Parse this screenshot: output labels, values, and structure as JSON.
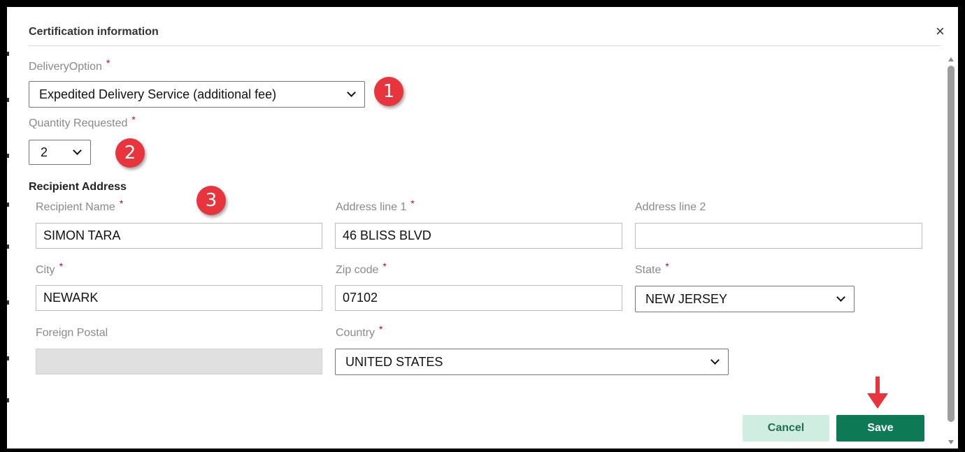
{
  "dialog": {
    "title": "Certification information",
    "close_glyph": "×"
  },
  "delivery_option": {
    "label": "DeliveryOption",
    "required_mark": "*",
    "value": "Expedited Delivery Service (additional fee)"
  },
  "quantity": {
    "label": "Quantity Requested",
    "required_mark": "*",
    "value": "2"
  },
  "recipient_address": {
    "section_title": "Recipient Address",
    "recipient_name": {
      "label": "Recipient Name",
      "required_mark": "*",
      "value": "SIMON TARA"
    },
    "address_line_1": {
      "label": "Address line 1",
      "required_mark": "*",
      "value": "46 BLISS BLVD"
    },
    "address_line_2": {
      "label": "Address line 2",
      "value": ""
    },
    "city": {
      "label": "City",
      "required_mark": "*",
      "value": "NEWARK"
    },
    "zip_code": {
      "label": "Zip code",
      "required_mark": "*",
      "value": "07102"
    },
    "state": {
      "label": "State",
      "required_mark": "*",
      "value": "NEW JERSEY"
    },
    "foreign_postal": {
      "label": "Foreign Postal",
      "value": ""
    },
    "country": {
      "label": "Country",
      "required_mark": "*",
      "value": "UNITED STATES"
    }
  },
  "buttons": {
    "cancel_label": "Cancel",
    "save_label": "Save"
  },
  "annotations": {
    "badge_1": "1",
    "badge_2": "2",
    "badge_3": "3"
  },
  "colors": {
    "required": "#a0142a",
    "save_bg": "#0e7a55",
    "cancel_bg": "#cfeee1",
    "badge": "#e8343c",
    "arrow": "#e8343c"
  },
  "icons": {
    "close": "close-icon",
    "dropdown": "chevron-down-icon",
    "arrow": "down-arrow-icon"
  }
}
